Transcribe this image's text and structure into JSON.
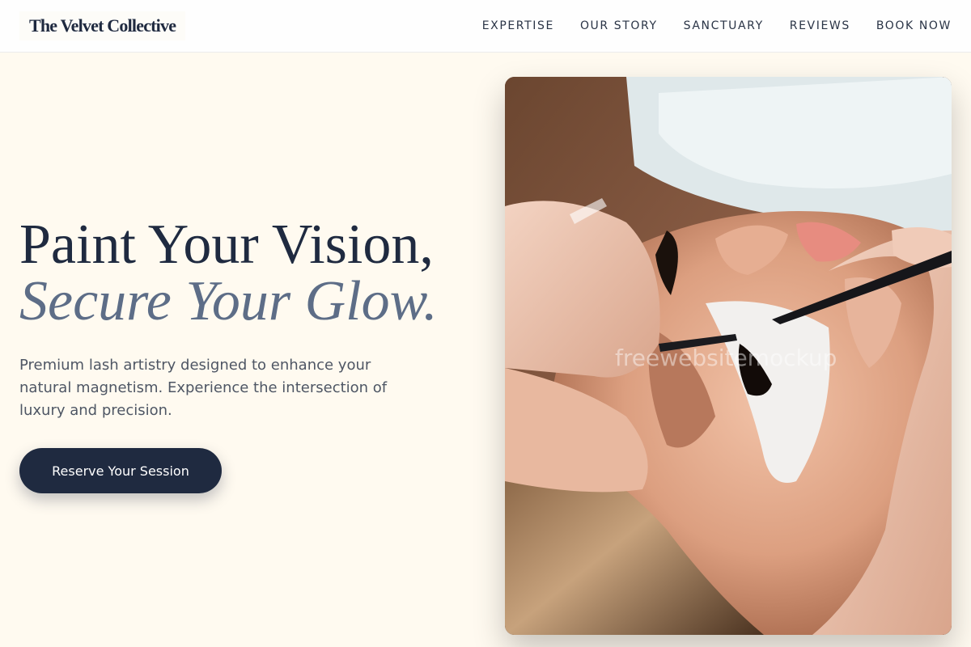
{
  "brand": {
    "name": "The Velvet Collective"
  },
  "nav": {
    "links": [
      "EXPERTISE",
      "OUR STORY",
      "SANCTUARY",
      "REVIEWS",
      "BOOK NOW"
    ]
  },
  "hero": {
    "title_line1": "Paint Your Vision,",
    "title_line2": "Secure Your Glow.",
    "subtitle": "Premium lash artistry designed to enhance your natural magnetism. Experience the intersection of luxury and precision.",
    "cta_label": "Reserve Your Session"
  },
  "image": {
    "alt": "Lash artist applying eyelash extensions with tweezers",
    "watermark": "freewebsitemockup"
  },
  "colors": {
    "background": "#fffaf0",
    "navy": "#1f2a40",
    "slate_italic": "#5d6d87",
    "body_text": "#4e5664"
  }
}
